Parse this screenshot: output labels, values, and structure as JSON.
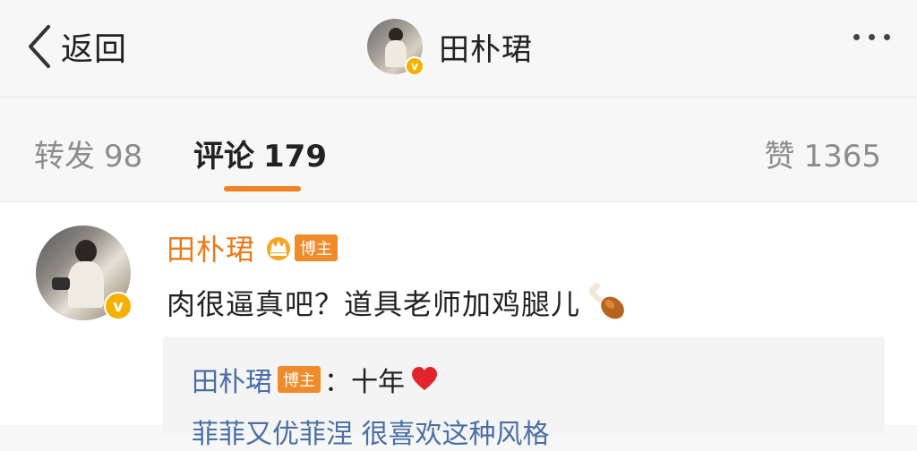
{
  "header": {
    "back_label": "返回",
    "title": "田朴珺",
    "verified_icon": "verified-badge-icon",
    "more_icon": "more-dots-icon"
  },
  "tabs": [
    {
      "label": "转发",
      "count": "98"
    },
    {
      "label": "评论",
      "count": "179",
      "active": true
    },
    {
      "label": "赞",
      "count": "1365"
    }
  ],
  "comment": {
    "author": "田朴珺",
    "badge": "博主",
    "text": "肉很逼真吧？道具老师加鸡腿儿",
    "emoji_icon": "drumstick-icon",
    "reply": {
      "author": "田朴珺",
      "badge": "博主",
      "text": "：十年",
      "emoji_icon": "heart-icon",
      "next_line": "菲菲又优菲涅 很喜欢这种风格"
    }
  },
  "colors": {
    "accent_orange": "#f08320",
    "author_orange": "#eb7a1a",
    "reply_blue": "#4a6fa5",
    "badge_orange": "#f08a2a"
  }
}
